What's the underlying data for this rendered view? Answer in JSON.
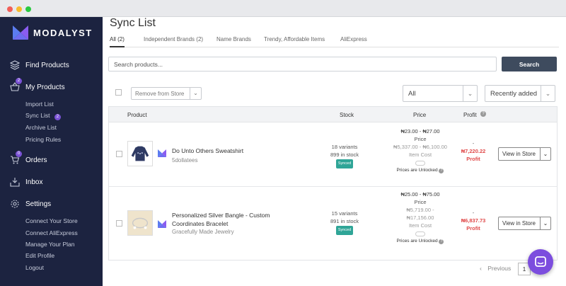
{
  "sidebar": {
    "logo": "MODALYST",
    "nav": {
      "find_products": "Find Products",
      "my_products": "My Products",
      "my_products_badge": "2",
      "orders": "Orders",
      "orders_badge": "0",
      "inbox": "Inbox",
      "settings": "Settings"
    },
    "my_products_sub": [
      "Import List",
      "Sync List",
      "Archive List",
      "Pricing Rules"
    ],
    "sync_list_badge": "2",
    "settings_sub": [
      "Connect Your Store",
      "Connect AliExpress",
      "Manage Your Plan",
      "Edit Profile",
      "Logout"
    ]
  },
  "page": {
    "title": "Sync List",
    "tabs": [
      "All (2)",
      "Independent Brands (2)",
      "Name Brands",
      "Trendy, Affordable Items",
      "AliExpress"
    ]
  },
  "search": {
    "placeholder": "Search products...",
    "button": "Search"
  },
  "toolbar": {
    "remove_label": "Remove from Store",
    "filter_value": "All",
    "sort_value": "Recently added"
  },
  "table": {
    "headers": {
      "product": "Product",
      "stock": "Stock",
      "price": "Price",
      "profit": "Profit"
    },
    "rows": [
      {
        "name": "Do Unto Others Sweatshirt",
        "name_line2": "",
        "vendor": "5dollatees",
        "variants": "18 variants",
        "stock": "899 in stock",
        "status": "Synced",
        "price": "₦23.00 - ₦27.00",
        "price_label": "Price",
        "cost": "₦5,337.00 - ₦6,100.00",
        "cost_line2": "",
        "cost_label": "Item Cost",
        "unlock": "Prices are Unlocked",
        "profit_dash": "-",
        "profit": "₦7,220.22",
        "profit_label": "Profit",
        "action": "View in Store"
      },
      {
        "name": "Personalized Silver Bangle - Custom",
        "name_line2": "Coordinates Bracelet",
        "vendor": "Gracefully Made Jewelry",
        "variants": "15 variants",
        "stock": "891 in stock",
        "status": "Synced",
        "price": "₦25.00 - ₦75.00",
        "price_label": "Price",
        "cost": "₦5,719.00 -",
        "cost_line2": "₦17,156.00",
        "cost_label": "Item Cost",
        "unlock": "Prices are Unlocked",
        "profit_dash": "-",
        "profit": "₦6,837.73",
        "profit_label": "Profit",
        "action": "View in Store"
      }
    ]
  },
  "pagination": {
    "previous": "Previous",
    "current": "1"
  },
  "colors": {
    "sidebar": "#1c2340",
    "accent": "#7b53d6",
    "synced": "#2fa597",
    "profit": "#e04a4a",
    "search_button": "#3e4b5e"
  }
}
